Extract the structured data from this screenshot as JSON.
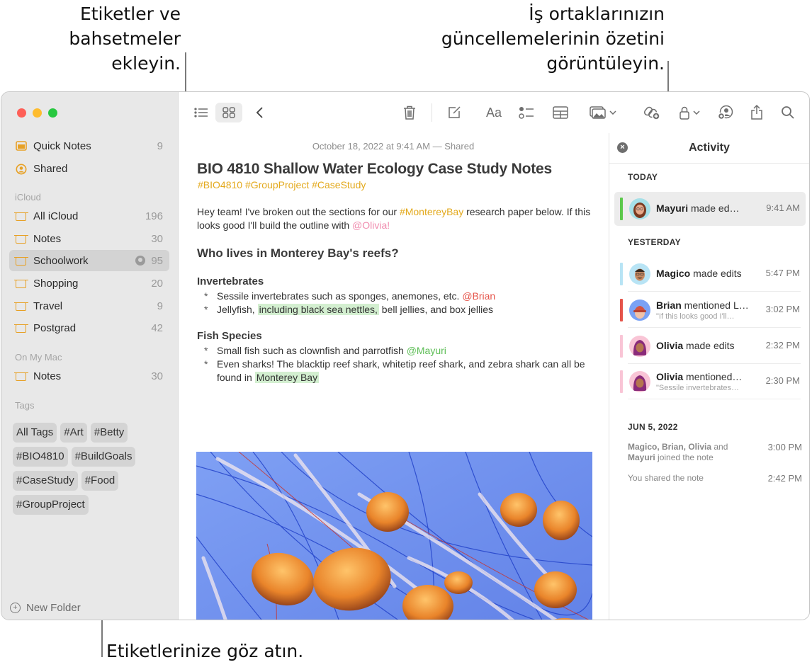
{
  "callouts": {
    "top_left": [
      "Etiketler ve",
      "bahsetmeler",
      "ekleyin."
    ],
    "top_right": [
      "İş ortaklarınızın",
      "güncellemelerinin özetini",
      "görüntüleyin."
    ],
    "bottom": "Etiketlerinize göz atın."
  },
  "sidebar": {
    "pinned": [
      {
        "label": "Quick Notes",
        "count": "9",
        "icon": "quick-notes-icon"
      },
      {
        "label": "Shared",
        "count": "",
        "icon": "shared-person-icon"
      }
    ],
    "icloud_label": "iCloud",
    "icloud_folders": [
      {
        "label": "All iCloud",
        "count": "196"
      },
      {
        "label": "Notes",
        "count": "30"
      },
      {
        "label": "Schoolwork",
        "count": "95",
        "selected": true,
        "shared": true
      },
      {
        "label": "Shopping",
        "count": "20"
      },
      {
        "label": "Travel",
        "count": "9"
      },
      {
        "label": "Postgrad",
        "count": "42"
      }
    ],
    "mac_label": "On My Mac",
    "mac_folders": [
      {
        "label": "Notes",
        "count": "30"
      }
    ],
    "tags_label": "Tags",
    "tags": [
      "All Tags",
      "#Art",
      "#Betty",
      "#BIO4810",
      "#BuildGoals",
      "#CaseStudy",
      "#Food",
      "#GroupProject"
    ],
    "new_folder": "New Folder"
  },
  "toolbar": {
    "list_view": "list-view-icon",
    "gallery_view": "gallery-view-icon",
    "back": "back-chevron-icon",
    "delete": "trash-icon",
    "compose": "compose-icon",
    "format": "Aa",
    "checklist": "checklist-icon",
    "table": "table-icon",
    "media": "media-icon",
    "collaborate": "collaborate-link-icon",
    "lock": "lock-icon",
    "participants": "participants-icon",
    "share": "share-icon",
    "search": "search-icon"
  },
  "note": {
    "date": "October 18, 2022 at 9:41 AM — Shared",
    "title": "BIO 4810 Shallow Water Ecology Case Study Notes",
    "tags": "#BIO4810 #GroupProject #CaseStudy",
    "intro": {
      "t1": "Hey team! I've broken out the sections for our ",
      "tag": "#MontereyBay",
      "t2": " research paper below. If this looks good I'll build the outline with ",
      "mention": "@Olivia!"
    },
    "heading": "Who lives in Monterey Bay's reefs?",
    "sub1": "Invertebrates",
    "b1": {
      "text": "Sessile invertebrates such as sponges, anemones, etc. ",
      "mention": "@Brian"
    },
    "b2": {
      "t1": "Jellyfish, ",
      "highlight": "including black sea nettles,",
      "t2": " bell jellies, and box jellies"
    },
    "sub2": "Fish Species",
    "b3": {
      "text": "Small fish such as clownfish and parrotfish ",
      "mention": "@Mayuri"
    },
    "b4": {
      "text": "Even sharks! The blacktip reef shark, whitetip reef shark, and zebra shark can all be found in ",
      "highlight": "Monterey Bay"
    },
    "bullet_char": "*",
    "image": "jellyfish-photo"
  },
  "activity": {
    "title": "Activity",
    "close": "×",
    "today_label": "TODAY",
    "today": [
      {
        "name": "Mayuri",
        "action": " made ed…",
        "time": "9:41 AM",
        "color": "#5cc84b",
        "avatar_bg": "#a6e0e8"
      }
    ],
    "yesterday_label": "YESTERDAY",
    "yesterday": [
      {
        "name": "Magico",
        "action": " made edits",
        "sub": "",
        "time": "5:47 PM",
        "color": "#b8e4f5",
        "avatar_bg": "#b8e4f5"
      },
      {
        "name": "Brian",
        "action": " mentioned L…",
        "sub": "\"If this looks good I'll…",
        "time": "3:02 PM",
        "color": "#e5544a",
        "avatar_bg": "#7aa2f5"
      },
      {
        "name": "Olivia",
        "action": " made edits",
        "sub": "",
        "time": "2:32 PM",
        "color": "#f9c5d6",
        "avatar_bg": "#f9c5d6"
      },
      {
        "name": "Olivia",
        "action": " mentioned…",
        "sub": "\"Sessile invertebrates…",
        "time": "2:30 PM",
        "color": "#f9c5d6",
        "avatar_bg": "#f9c5d6"
      }
    ],
    "older_label": "JUN 5, 2022",
    "older": [
      {
        "names": "Magico, Brian, Olivia",
        "mid": " and ",
        "last": "Mayuri",
        "rest": " joined the note",
        "time": "3:00 PM"
      },
      {
        "text": "You shared the note",
        "time": "2:42 PM"
      }
    ]
  }
}
